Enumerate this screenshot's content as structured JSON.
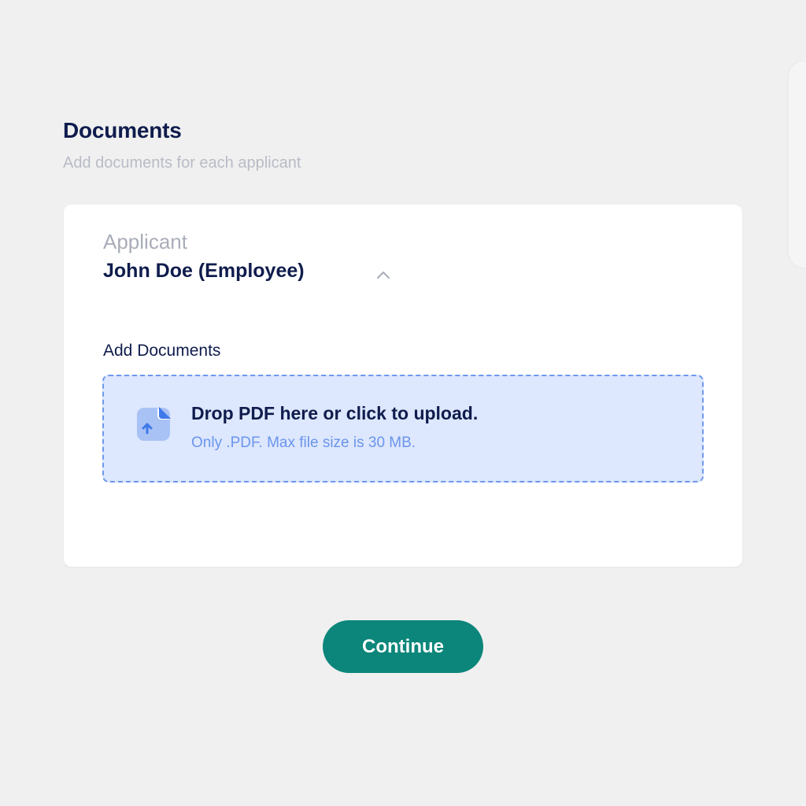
{
  "header": {
    "title": "Documents",
    "subtitle": "Add documents for each applicant"
  },
  "applicant": {
    "label": "Applicant",
    "name": "John Doe (Employee)",
    "toggle_icon": "chevron-up-icon",
    "expanded": true
  },
  "documents": {
    "section_label": "Add Documents",
    "dropzone": {
      "icon": "file-upload-icon",
      "title": "Drop PDF here or click to upload.",
      "hint": "Only .PDF. Max file size is 30 MB."
    }
  },
  "actions": {
    "continue_label": "Continue"
  },
  "colors": {
    "background": "#f0f0f0",
    "heading": "#0f1c4d",
    "muted": "#b8bcc6",
    "dropzone_fill": "#dde7fd",
    "dropzone_border": "#6d98ec",
    "accent_blue": "#6b95ec",
    "primary_button": "#0c867a"
  }
}
